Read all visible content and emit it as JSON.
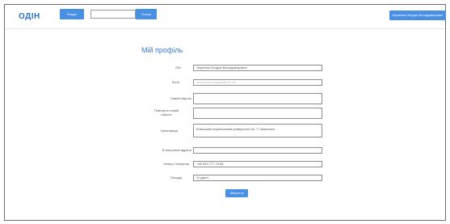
{
  "header": {
    "logo": "ОДІН",
    "menu_button": "Розділ",
    "search": {
      "placeholder": "",
      "value": ""
    },
    "search_button": "Пошук",
    "user_button": "Черненко Богдан Володимирович"
  },
  "profile": {
    "title": "Мій профіль",
    "fields": [
      {
        "label": "ПІБ",
        "value": "Черненко Богдан Володимирович"
      },
      {
        "label": "Логін",
        "value": "chernenko.bogdan@ukr.net"
      },
      {
        "label": "Новий пароль",
        "value": ""
      },
      {
        "label": "Повторіть новий пароль",
        "value": ""
      },
      {
        "label": "Організація",
        "value": "Київський національний університет ім. Т. Шевченка"
      },
      {
        "label": "Електронна адреса",
        "value": "..."
      },
      {
        "label": "Номер телефону",
        "value": "+38 099 777 76 66"
      },
      {
        "label": "Посада",
        "value": "Студент"
      }
    ],
    "save_button": "Зберегти"
  },
  "colors": {
    "accent": "#4a90e2",
    "title": "#3a7bd5"
  }
}
